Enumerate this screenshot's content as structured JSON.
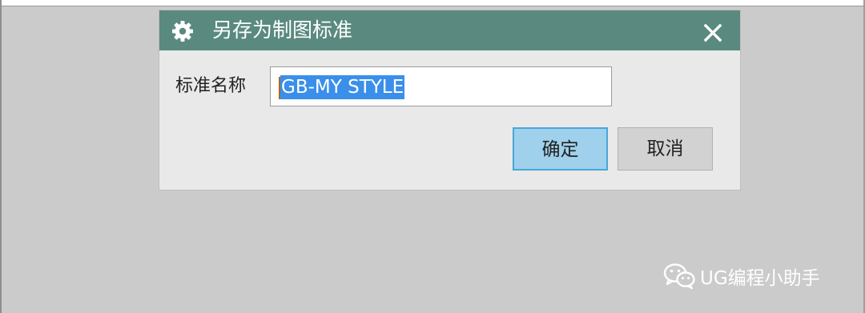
{
  "dialog": {
    "title": "另存为制图标准",
    "title_icon": "gear-icon",
    "close_icon": "close-icon",
    "field_label": "标准名称",
    "input_value": "GB-MY STYLE",
    "ok_label": "确定",
    "cancel_label": "取消"
  },
  "watermark": {
    "icon": "wechat-icon",
    "text": "UG编程小助手"
  },
  "colors": {
    "titlebar": "#5a8a7f",
    "dialog_bg": "#e9e9e9",
    "backdrop": "#cbcbcb",
    "selection": "#3a8fea",
    "ok_button": "#9fd0ec",
    "ok_border": "#49a6d9",
    "cancel_button": "#d2d2d2"
  }
}
